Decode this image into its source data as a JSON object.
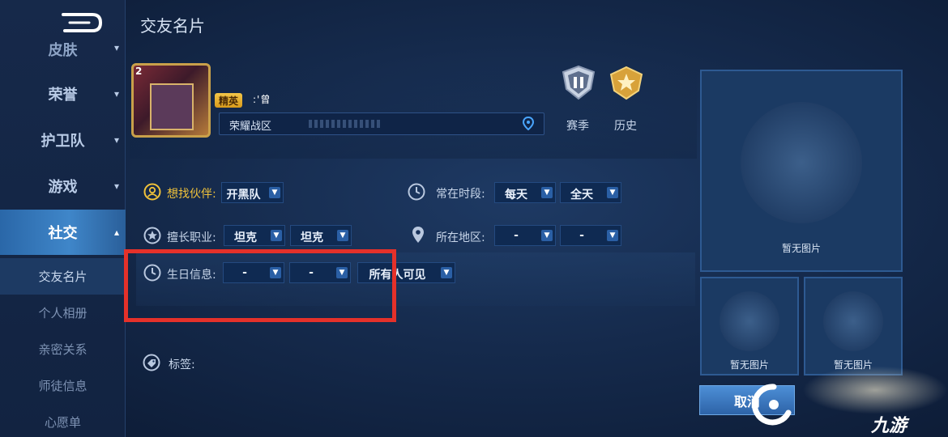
{
  "page_title": "交友名片",
  "sidebar": {
    "partial_item": "皮肤",
    "items": [
      {
        "label": "荣誉",
        "chevron": "▾"
      },
      {
        "label": "护卫队",
        "chevron": "▾"
      },
      {
        "label": "游戏",
        "chevron": "▾"
      },
      {
        "label": "社交",
        "chevron": "▴"
      }
    ],
    "sub_items": [
      "交友名片",
      "个人相册",
      "亲密关系",
      "师徒信息",
      "心愿单"
    ]
  },
  "profile": {
    "level_badge": "2",
    "rank_badge": "精英",
    "player_name": ":'曾",
    "server": "荣耀战区"
  },
  "season_icons": [
    {
      "label": "赛季",
      "icon": "season-ii-shield-icon"
    },
    {
      "label": "历史",
      "icon": "gold-star-badge-icon"
    }
  ],
  "fields": {
    "partner": {
      "label": "想找伙伴:",
      "value": "开黑队"
    },
    "online_time": {
      "label": "常在时段:",
      "values": [
        "每天",
        "全天"
      ]
    },
    "role": {
      "label": "擅长职业:",
      "values": [
        "坦克",
        "坦克"
      ]
    },
    "region": {
      "label": "所在地区:",
      "values": [
        "-",
        "-"
      ]
    },
    "birthday": {
      "label": "生日信息:",
      "values": [
        "-",
        "-"
      ],
      "visibility": "所有人可见"
    },
    "tags": {
      "label": "标签:"
    }
  },
  "photos": {
    "main_label": "暂无图片",
    "small_labels": [
      "暂无图片",
      "暂无图片"
    ]
  },
  "cancel_button": "取消",
  "watermark": "九游",
  "colors": {
    "accent": "#f0c23a",
    "highlight": "#e5312a",
    "active_tab": "#3f86c9"
  }
}
